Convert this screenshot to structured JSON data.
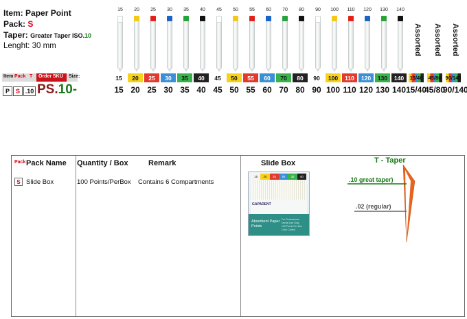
{
  "item": {
    "label": "Item:",
    "value": "Paper Point"
  },
  "pack": {
    "label": "Pack:",
    "value": "S"
  },
  "taper": {
    "label": "Taper:",
    "value": "Greater Taper ISO.",
    "suffix": "10"
  },
  "length": {
    "label": "Lenght:",
    "value": "30 mm"
  },
  "points": [
    {
      "size": "15",
      "cap": "#ffffff"
    },
    {
      "size": "20",
      "cap": "#f3c914"
    },
    {
      "size": "25",
      "cap": "#e3201b"
    },
    {
      "size": "30",
      "cap": "#1a64c8"
    },
    {
      "size": "35",
      "cap": "#28a23a"
    },
    {
      "size": "40",
      "cap": "#111111"
    },
    {
      "size": "45",
      "cap": "#ffffff"
    },
    {
      "size": "50",
      "cap": "#f3c914"
    },
    {
      "size": "55",
      "cap": "#e3201b"
    },
    {
      "size": "60",
      "cap": "#1a64c8"
    },
    {
      "size": "70",
      "cap": "#28a23a"
    },
    {
      "size": "80",
      "cap": "#111111"
    },
    {
      "size": "90",
      "cap": "#ffffff"
    },
    {
      "size": "100",
      "cap": "#f3c914"
    },
    {
      "size": "110",
      "cap": "#e3201b"
    },
    {
      "size": "120",
      "cap": "#1a64c8"
    },
    {
      "size": "130",
      "cap": "#28a23a"
    },
    {
      "size": "140",
      "cap": "#111111"
    }
  ],
  "assorted": [
    "Assorted",
    "Assorted",
    "Assorted"
  ],
  "swatches": [
    {
      "label": "15",
      "bg": "#ffffff",
      "fg": "#111"
    },
    {
      "label": "20",
      "bg": "#f6d21c",
      "fg": "#111"
    },
    {
      "label": "25",
      "bg": "#e23b2e",
      "fg": "#fff"
    },
    {
      "label": "30",
      "bg": "#3a8fd6",
      "fg": "#fff"
    },
    {
      "label": "35",
      "bg": "#38b24a",
      "fg": "#111"
    },
    {
      "label": "40",
      "bg": "#222222",
      "fg": "#fff"
    },
    {
      "label": "45",
      "bg": "#ffffff",
      "fg": "#111"
    },
    {
      "label": "50",
      "bg": "#f6d21c",
      "fg": "#111"
    },
    {
      "label": "55",
      "bg": "#e23b2e",
      "fg": "#fff"
    },
    {
      "label": "60",
      "bg": "#3a8fd6",
      "fg": "#fff"
    },
    {
      "label": "70",
      "bg": "#38b24a",
      "fg": "#111"
    },
    {
      "label": "80",
      "bg": "#222222",
      "fg": "#fff"
    },
    {
      "label": "90",
      "bg": "#ffffff",
      "fg": "#111"
    },
    {
      "label": "100",
      "bg": "#f6d21c",
      "fg": "#111"
    },
    {
      "label": "110",
      "bg": "#e23b2e",
      "fg": "#fff"
    },
    {
      "label": "120",
      "bg": "#3a8fd6",
      "fg": "#fff"
    },
    {
      "label": "130",
      "bg": "#38b24a",
      "fg": "#111"
    },
    {
      "label": "140",
      "bg": "#222222",
      "fg": "#fff"
    },
    {
      "label": "15/40",
      "bg": "multi1",
      "fg": "#111"
    },
    {
      "label": "45/80",
      "bg": "multi2",
      "fg": "#111"
    },
    {
      "label": "90/140",
      "bg": "multi3",
      "fg": "#111"
    }
  ],
  "sizes": [
    "15",
    "20",
    "25",
    "30",
    "35",
    "40",
    "45",
    "50",
    "55",
    "60",
    "70",
    "80",
    "90",
    "100",
    "110",
    "120",
    "130",
    "140",
    "15/40",
    "45/80",
    "90/140"
  ],
  "sku_header": {
    "item": "Item",
    "pack": "Pack",
    "t": "T",
    "order": "Order SKU",
    "size": "Size:"
  },
  "sku_codes": {
    "p": "P",
    "s": "S",
    "t": ".10"
  },
  "sku": {
    "prefix": "PS.",
    "suffix": "10-"
  },
  "table": {
    "pack_small": "Pack",
    "pack_name": "Pack Name",
    "qty": "Quantity / Box",
    "remark": "Remark",
    "slide_box": "Slide Box",
    "taper_title": "T - Taper",
    "row_code": "S",
    "row_name": "Slide Box",
    "row_qty": "100 Points/PerBox",
    "row_remark": "Contains 6 Compartments"
  },
  "box": {
    "labels": [
      "15",
      "20",
      "25",
      "30",
      "35",
      "40"
    ],
    "label_colors": [
      "#f4f4f4",
      "#f6d21c",
      "#e23b2e",
      "#3a8fd6",
      "#38b24a",
      "#222"
    ],
    "brand": "GAPADENT",
    "title_line1": "Absorbent Paper",
    "title_line2": "Points",
    "sub1": "For Professional",
    "sub2": "Dental Use Only",
    "sub3": "100 Points Per Box",
    "sub4": "Color Coded"
  },
  "callouts": {
    "great": ".10 great taper)",
    "regular": ".02 (regular)"
  },
  "colors": {
    "accent_red": "#e0000c",
    "accent_green": "#1a7a1a",
    "taper_orange": "#e8641e"
  }
}
